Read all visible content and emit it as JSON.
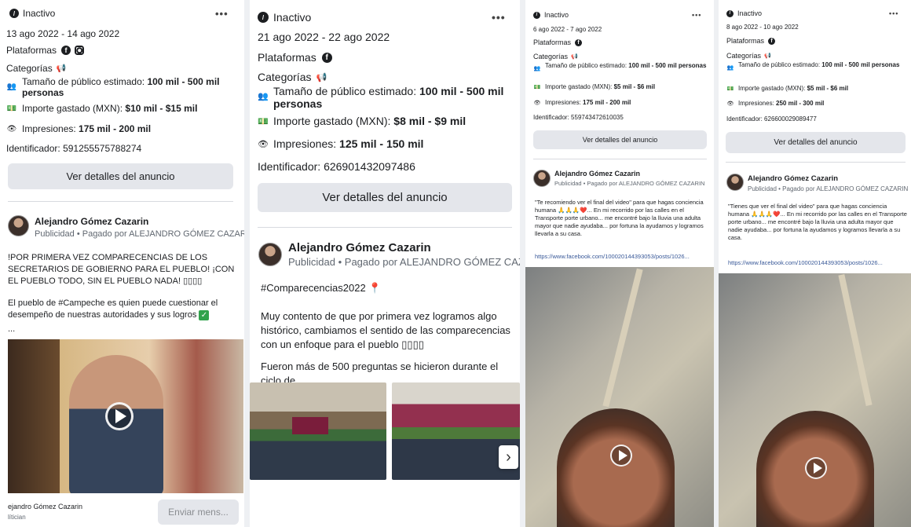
{
  "status_text": "Inactivo",
  "more_label": "•••",
  "platforms_label": "Plataformas",
  "categories_label": "Categorías",
  "audience_label": "Tamaño de público estimado:",
  "audience_value": "100 mil - 500 mil personas",
  "spend_label": "Importe gastado (MXN):",
  "impressions_label": "Impresiones:",
  "id_label": "Identificador:",
  "details_button": "Ver detalles del anuncio",
  "advertiser": "Alejandro Gómez Cazarin",
  "ad_label": "Publicidad",
  "paid_by": "Pagado por ALEJANDRO GÓMEZ CAZARIN",
  "cards": [
    {
      "dates": "13 ago 2022 - 14 ago 2022",
      "spend": "$10 mil - $15 mil",
      "impressions": "175 mil - 200 mil",
      "id": "591255575788274",
      "text1": "!POR PRIMERA VEZ COMPARECENCIAS DE LOS SECRETARIOS DE GOBIERNO PARA EL PUEBLO! ¡CON EL PUEBLO TODO, SIN EL PUEBLO NADA! ▯▯▯▯",
      "text2": "El pueblo de #Campeche es quien puede cuestionar el desempeño de nuestras autoridades y sus logros",
      "ellipsis": "...",
      "footer_name": "ejandro Gómez Cazarin",
      "footer_sub": "lítician",
      "message_button": "Enviar mens..."
    },
    {
      "dates": "21 ago 2022 - 22 ago 2022",
      "spend": "$8 mil - $9 mil",
      "impressions": "125 mil - 150 mil",
      "id": "626901432097486",
      "hashtag": "#Comparecencias2022",
      "text1": "Muy contento de que por primera vez logramos algo histórico, cambiamos el sentido de las comparecencias con un enfoque para el pueblo ▯▯▯▯",
      "text2": "Fueron más de 500 preguntas se hicieron durante el ciclo de..."
    },
    {
      "dates": "6 ago 2022 - 7 ago 2022",
      "spend": "$5 mil - $6 mil",
      "impressions": "175 mil - 200 mil",
      "id": "559743472610035",
      "text": "\"Te recomiendo ver el final del video\" para que hagas conciencia humana 🙏🙏🙏❤️... En mi recorrido por las calles en el Transporte porte urbano... me encontré bajo la lluvia una adulta mayor que nadie ayudaba... por fortuna la ayudamos y logramos llevarla a su casa.",
      "url": "https://www.facebook.com/100020144393053/posts/1026..."
    },
    {
      "dates": "8 ago 2022 - 10 ago 2022",
      "spend": "$5 mil - $6 mil",
      "impressions": "250 mil - 300 mil",
      "id": "626600029089477",
      "text": "\"Tienes que ver el final del video\" para que hagas conciencia humana 🙏🙏🙏❤️... En mi recorrido por las calles en el Transporte porte urbano... me encontré bajo la lluvia una adulta mayor que nadie ayudaba... por fortuna la ayudamos y logramos llevarla a su casa.",
      "url": "https://www.facebook.com/100020144393053/posts/1026..."
    }
  ]
}
